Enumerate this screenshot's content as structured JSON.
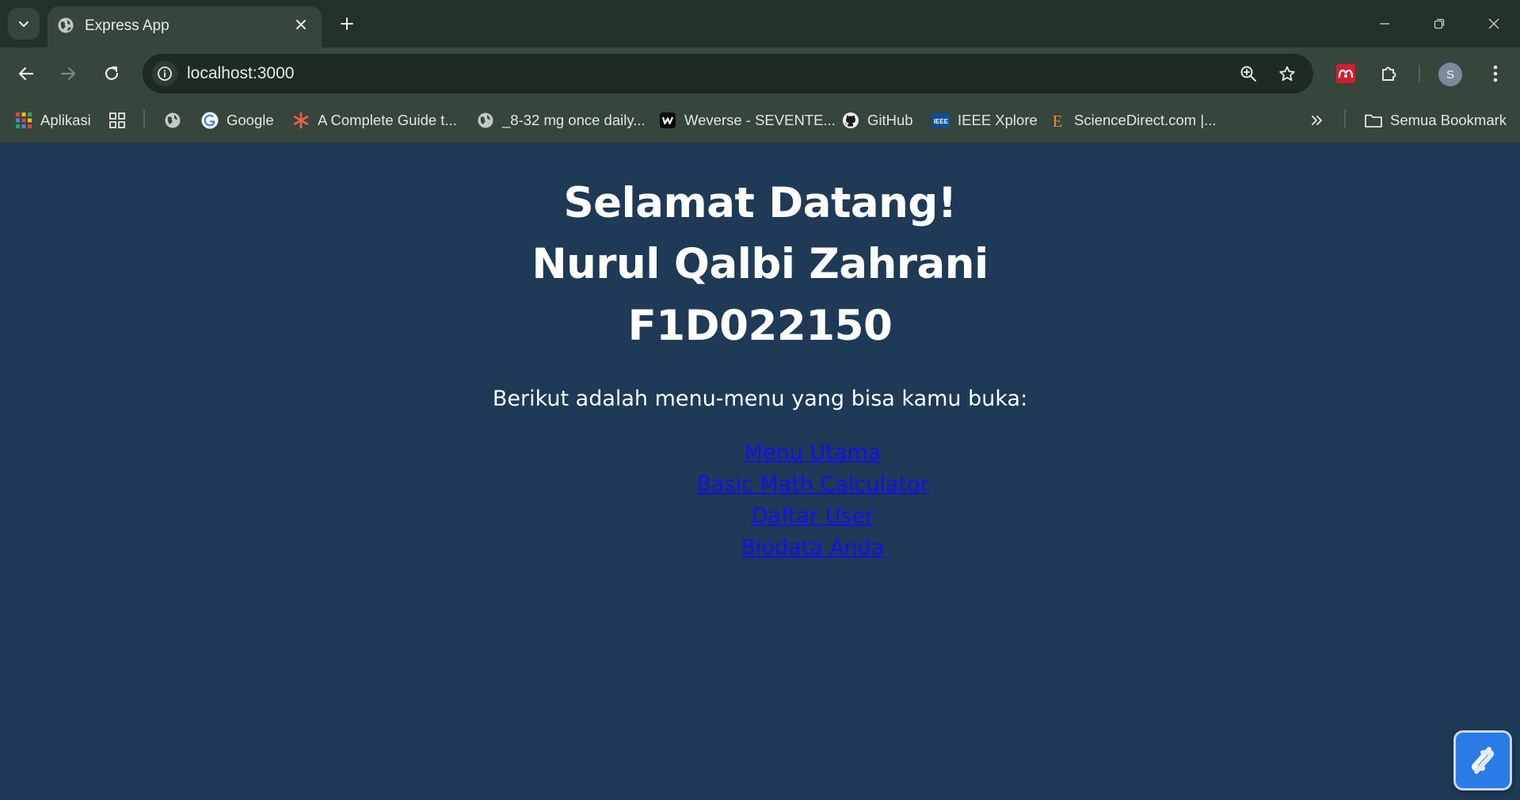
{
  "browser": {
    "tab_title": "Express App",
    "url": "localhost:3000",
    "profile_initial": "S",
    "bookmarks": [
      {
        "label": "Aplikasi",
        "icon": "apps-grid-icon"
      },
      {
        "label": "",
        "icon": "tab-groups-icon"
      },
      {
        "label": "",
        "icon": "globe-icon"
      },
      {
        "label": "Google",
        "icon": "google-icon"
      },
      {
        "label": "A Complete Guide t...",
        "icon": "asterisk-icon"
      },
      {
        "label": "_8-32 mg once daily...",
        "icon": "globe-icon"
      },
      {
        "label": "Weverse - SEVENTE...",
        "icon": "weverse-icon"
      },
      {
        "label": "GitHub",
        "icon": "github-icon"
      },
      {
        "label": "IEEE Xplore",
        "icon": "ieee-icon"
      },
      {
        "label": "ScienceDirect.com |...",
        "icon": "elsevier-icon"
      }
    ],
    "all_bookmarks_label": "Semua Bookmark"
  },
  "page": {
    "heading_line1": "Selamat Datang!",
    "heading_line2": "Nurul Qalbi Zahrani",
    "heading_line3": "F1D022150",
    "intro": "Berikut adalah menu-menu yang bisa kamu buka:",
    "links": [
      "Menu Utama",
      "Basic Math Calculator",
      "Daftar User",
      "Biodata Anda"
    ]
  },
  "colors": {
    "page_background": "#1e3a56",
    "link": "#1a0dee",
    "chrome_frame": "#24332a",
    "chrome_toolbar": "#36463c"
  }
}
